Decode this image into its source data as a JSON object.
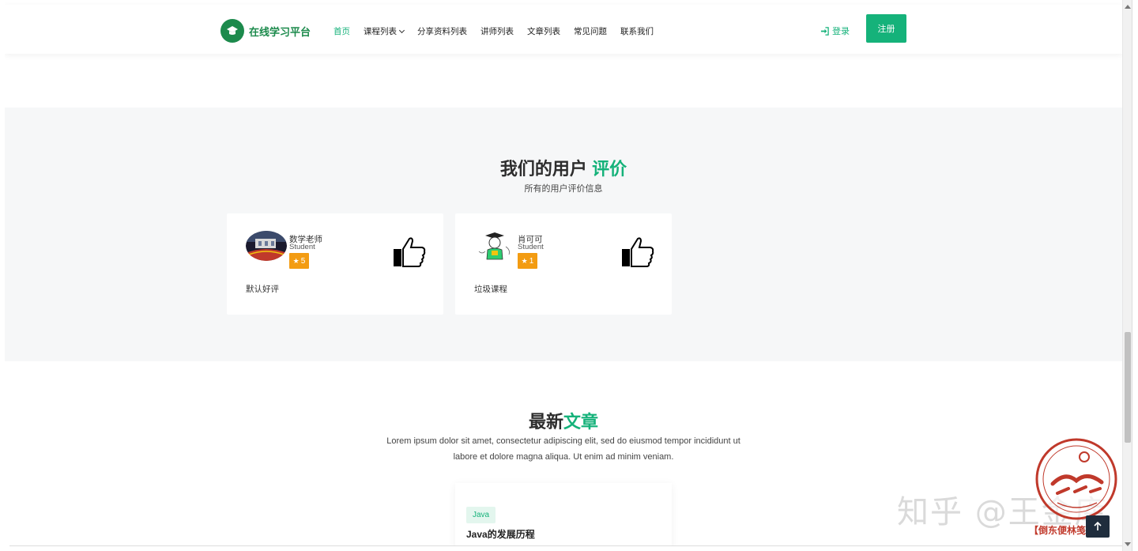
{
  "header": {
    "logo_text": "在线学习平台",
    "nav": [
      {
        "label": "首页",
        "active": true
      },
      {
        "label": "课程列表",
        "dropdown": true
      },
      {
        "label": "分享资料列表"
      },
      {
        "label": "讲师列表"
      },
      {
        "label": "文章列表"
      },
      {
        "label": "常见问题"
      },
      {
        "label": "联系我们"
      }
    ],
    "login_label": "登录",
    "register_label": "注册"
  },
  "reviews": {
    "title_main": "我们的用户",
    "title_accent": "评价",
    "subtitle": "所有的用户评价信息",
    "cards": [
      {
        "name": "数学老师",
        "role": "Student",
        "rating": "5",
        "comment": "默认好评",
        "icon": "thumbs-up-icon"
      },
      {
        "name": "肖可可",
        "role": "Student",
        "rating": "1",
        "comment": "垃圾课程",
        "icon": "thumbs-up-icon"
      }
    ]
  },
  "articles": {
    "title_main": "最新",
    "title_accent": "文章",
    "desc_line1": "Lorem ipsum dolor sit amet, consectetur adipiscing elit, sed do eiusmod tempor incididunt ut",
    "desc_line2": "labore et dolore magna aliqua. Ut enim ad minim veniam.",
    "card": {
      "tag": "Java",
      "title": "Java的发展历程"
    }
  },
  "watermark": {
    "text": "知乎 @王金库",
    "seal_caption": "【倒东便林笺亮】"
  },
  "colors": {
    "accent": "#15b27a",
    "logo_green": "#1c8a4c",
    "rating_orange": "#f39c12",
    "section_bg": "#f6f7f8",
    "back_top_bg": "#1f2d3d"
  }
}
